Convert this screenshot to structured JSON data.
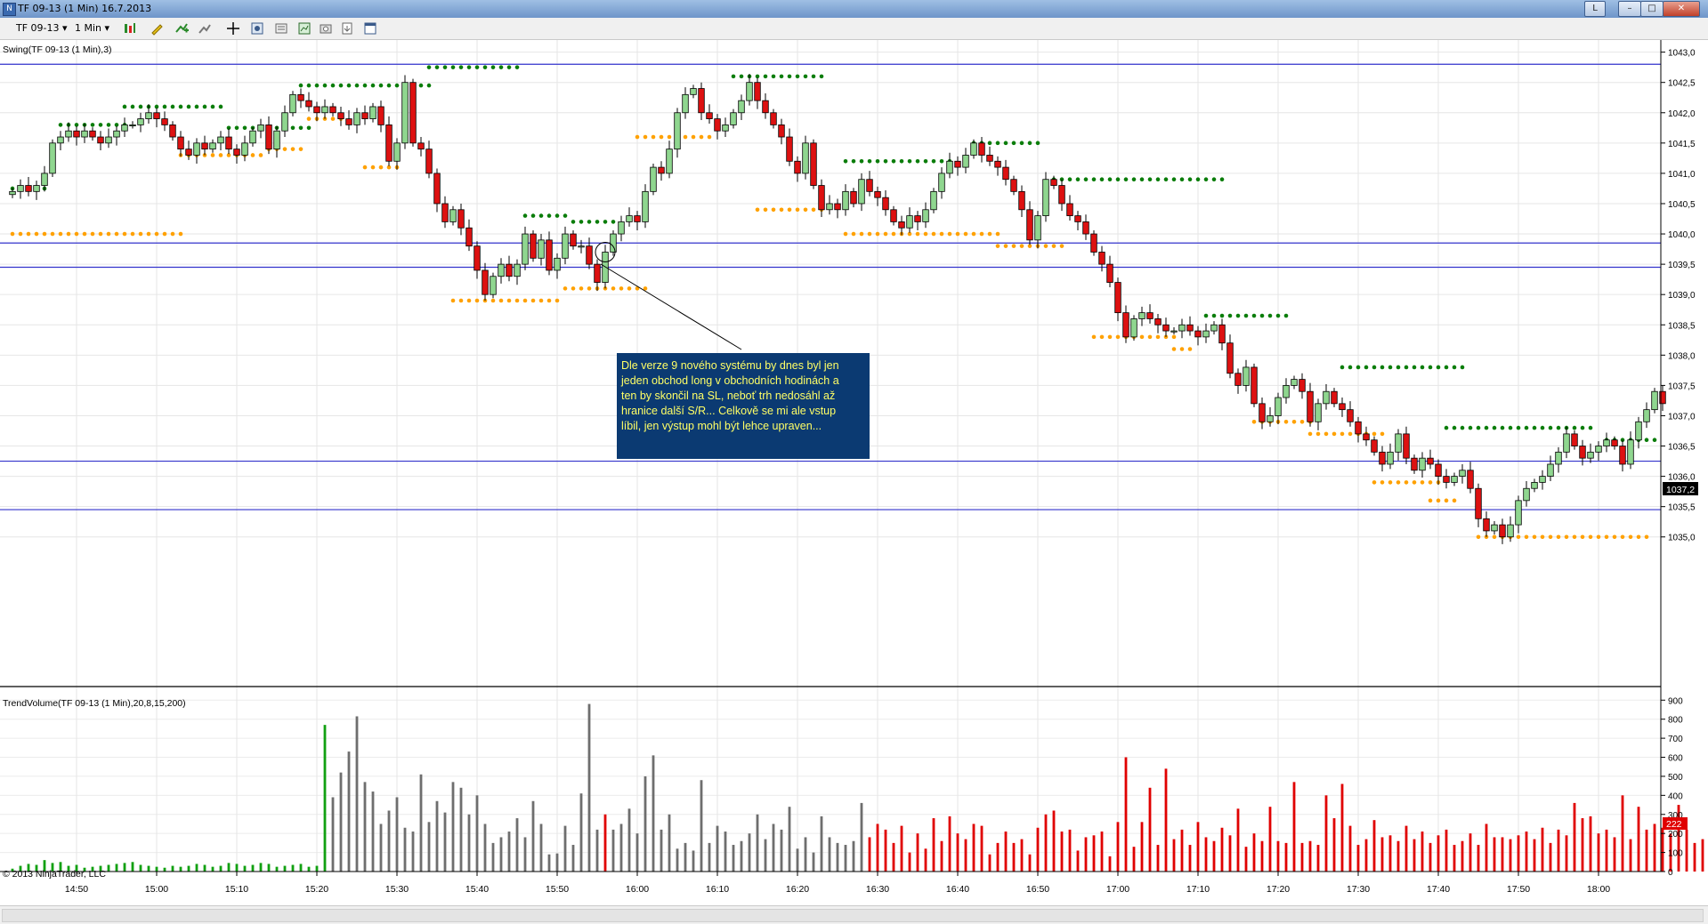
{
  "window": {
    "title": "TF 09-13 (1 Min)  16.7.2013",
    "buttons": [
      "L",
      "–",
      "□",
      "✕"
    ]
  },
  "toolbar": {
    "instrument": "TF 09-13",
    "interval": "1 Min"
  },
  "panels": {
    "price_label": "Swing(TF 09-13 (1 Min),3)",
    "volume_label": "TrendVolume(TF 09-13 (1 Min),20,8,15,200)",
    "copyright": "© 2013 NinjaTrader, LLC",
    "annotation_lines": [
      "Dle verze 9 nového systému by dnes byl jen",
      "jeden obchod long v obchodních hodinách a",
      "ten by skončil na SL, neboť trh nedosáhl až",
      "hranice další S/R... Celkově se mi ale vstup",
      "líbil, jen výstup mohl být lehce upraven..."
    ],
    "last_price": "1037,2",
    "last_volume": "222"
  },
  "chart_data": [
    {
      "type": "candlestick",
      "title": "Swing(TF 09-13 (1 Min),3)",
      "x_ticks": [
        "14:50",
        "15:00",
        "15:10",
        "15:20",
        "15:30",
        "15:40",
        "15:50",
        "16:00",
        "16:10",
        "16:20",
        "16:30",
        "16:40",
        "16:50",
        "17:00",
        "17:10",
        "17:20",
        "17:30",
        "17:40",
        "17:50",
        "18:00"
      ],
      "y_ticks": [
        "1043,0",
        "1042,5",
        "1042,0",
        "1041,5",
        "1041,0",
        "1040,5",
        "1040,0",
        "1039,5",
        "1039,0",
        "1038,5",
        "1038,0",
        "1037,5",
        "1037,0",
        "1036,5",
        "1036,0",
        "1035,5",
        "1035,0"
      ],
      "ylim": [
        1034.6,
        1043.2
      ],
      "x_start": "14:42",
      "close": [
        1040.7,
        1040.8,
        1040.7,
        1040.8,
        1041.0,
        1041.5,
        1041.6,
        1041.7,
        1041.6,
        1041.7,
        1041.6,
        1041.5,
        1041.6,
        1041.7,
        1041.8,
        1041.8,
        1041.9,
        1042.0,
        1041.9,
        1041.8,
        1041.6,
        1041.4,
        1041.3,
        1041.5,
        1041.4,
        1041.5,
        1041.6,
        1041.4,
        1041.3,
        1041.5,
        1041.7,
        1041.8,
        1041.4,
        1041.7,
        1042.0,
        1042.3,
        1042.2,
        1042.1,
        1042.0,
        1042.1,
        1042.0,
        1041.9,
        1041.8,
        1042.0,
        1041.9,
        1042.1,
        1041.8,
        1041.2,
        1041.5,
        1042.5,
        1041.5,
        1041.4,
        1041.0,
        1040.5,
        1040.2,
        1040.4,
        1040.1,
        1039.8,
        1039.4,
        1039.0,
        1039.3,
        1039.5,
        1039.3,
        1039.5,
        1040.0,
        1039.6,
        1039.9,
        1039.4,
        1039.6,
        1040.0,
        1039.8,
        1039.8,
        1039.5,
        1039.2,
        1039.7,
        1040.0,
        1040.2,
        1040.3,
        1040.2,
        1040.7,
        1041.1,
        1041.0,
        1041.4,
        1042.0,
        1042.3,
        1042.4,
        1042.0,
        1041.9,
        1041.7,
        1041.8,
        1042.0,
        1042.2,
        1042.5,
        1042.2,
        1042.0,
        1041.8,
        1041.6,
        1041.2,
        1041.0,
        1041.5,
        1040.8,
        1040.4,
        1040.5,
        1040.4,
        1040.7,
        1040.5,
        1040.9,
        1040.7,
        1040.6,
        1040.4,
        1040.2,
        1040.1,
        1040.3,
        1040.2,
        1040.4,
        1040.7,
        1041.0,
        1041.2,
        1041.1,
        1041.3,
        1041.5,
        1041.3,
        1041.2,
        1041.1,
        1040.9,
        1040.7,
        1040.4,
        1039.9,
        1040.3,
        1040.9,
        1040.8,
        1040.5,
        1040.3,
        1040.2,
        1040.0,
        1039.7,
        1039.5,
        1039.2,
        1038.7,
        1038.3,
        1038.6,
        1038.7,
        1038.6,
        1038.5,
        1038.4,
        1038.4,
        1038.5,
        1038.4,
        1038.3,
        1038.4,
        1038.5,
        1038.2,
        1037.7,
        1037.5,
        1037.8,
        1037.2,
        1036.9,
        1037.0,
        1037.3,
        1037.5,
        1037.6,
        1037.4,
        1036.9,
        1037.2,
        1037.4,
        1037.2,
        1037.1,
        1036.9,
        1036.7,
        1036.6,
        1036.4,
        1036.2,
        1036.4,
        1036.7,
        1036.3,
        1036.1,
        1036.3,
        1036.2,
        1036.0,
        1035.9,
        1036.0,
        1036.1,
        1035.8,
        1035.3,
        1035.1,
        1035.2,
        1035.0,
        1035.2,
        1035.6,
        1035.8,
        1035.9,
        1036.0,
        1036.2,
        1036.4,
        1036.7,
        1036.5,
        1036.3,
        1036.4,
        1036.5,
        1036.6,
        1036.5,
        1036.2,
        1036.6,
        1036.9,
        1037.1,
        1037.4,
        1037.2
      ]
    },
    {
      "type": "bar",
      "title": "TrendVolume(TF 09-13 (1 Min),20,8,15,200)",
      "y_ticks": [
        "900",
        "800",
        "700",
        "600",
        "500",
        "400",
        "300",
        "200",
        "100",
        "0"
      ],
      "ylim": [
        0,
        920
      ],
      "values": [
        15,
        30,
        40,
        35,
        60,
        45,
        50,
        30,
        35,
        20,
        25,
        30,
        35,
        40,
        45,
        50,
        35,
        30,
        25,
        20,
        30,
        25,
        30,
        40,
        35,
        25,
        30,
        45,
        40,
        30,
        35,
        45,
        40,
        25,
        30,
        35,
        40,
        25,
        30,
        770,
        390,
        520,
        630,
        815,
        470,
        420,
        250,
        320,
        390,
        230,
        210,
        510,
        260,
        370,
        310,
        470,
        440,
        300,
        400,
        250,
        150,
        180,
        210,
        280,
        180,
        370,
        250,
        90,
        95,
        240,
        140,
        410,
        880,
        220,
        300,
        220,
        250,
        330,
        200,
        500,
        610,
        220,
        300,
        120,
        150,
        110,
        480,
        150,
        240,
        210,
        140,
        160,
        200,
        300,
        170,
        250,
        220,
        340,
        120,
        180,
        100,
        290,
        180,
        150,
        140,
        160,
        360,
        180,
        250,
        220,
        150,
        240,
        100,
        200,
        120,
        280,
        160,
        290,
        200,
        170,
        250,
        240,
        90,
        150,
        210,
        150,
        170,
        90,
        230,
        300,
        320,
        210,
        220,
        110,
        180,
        190,
        210,
        80,
        260,
        600,
        130,
        260,
        440,
        140,
        540,
        170,
        220,
        140,
        260,
        180,
        160,
        230,
        190,
        330,
        130,
        200,
        160,
        340,
        160,
        150,
        470,
        150,
        160,
        140,
        400,
        280,
        460,
        240,
        140,
        170,
        270,
        180,
        190,
        160,
        240,
        170,
        210,
        150,
        190,
        220,
        140,
        160,
        200,
        140,
        250,
        180,
        180,
        170,
        190,
        210,
        170,
        230,
        150,
        220,
        190,
        360,
        280,
        290,
        200,
        220,
        180,
        400,
        170,
        340,
        220,
        250,
        230,
        200,
        350,
        220,
        150,
        170,
        200,
        180,
        160,
        200,
        150,
        210,
        350,
        160,
        220,
        140,
        190,
        560,
        170,
        230,
        250,
        280,
        190,
        240,
        160,
        180,
        250,
        222
      ],
      "colors": "green before 15:31, gray 15:31–15:56, red at 15:57, gray until 16:56, red after"
    }
  ],
  "horizontal_lines": [
    1042.8,
    1039.85,
    1039.45,
    1036.25,
    1035.45
  ],
  "swing_levels": {
    "resistance": [
      {
        "level": 1040.75,
        "from": 0,
        "to": 4
      },
      {
        "level": 1041.8,
        "from": 6,
        "to": 14
      },
      {
        "level": 1042.1,
        "from": 14,
        "to": 26
      },
      {
        "level": 1041.75,
        "from": 27,
        "to": 37
      },
      {
        "level": 1042.45,
        "from": 36,
        "to": 52
      },
      {
        "level": 1042.75,
        "from": 52,
        "to": 63
      },
      {
        "level": 1040.3,
        "from": 64,
        "to": 69
      },
      {
        "level": 1040.2,
        "from": 70,
        "to": 75
      },
      {
        "level": 1042.6,
        "from": 90,
        "to": 101
      },
      {
        "level": 1041.2,
        "from": 104,
        "to": 117
      },
      {
        "level": 1041.5,
        "from": 120,
        "to": 128
      },
      {
        "level": 1040.9,
        "from": 130,
        "to": 151
      },
      {
        "level": 1038.65,
        "from": 149,
        "to": 159
      },
      {
        "level": 1037.8,
        "from": 166,
        "to": 181
      },
      {
        "level": 1036.8,
        "from": 179,
        "to": 197
      },
      {
        "level": 1036.6,
        "from": 199,
        "to": 205
      }
    ],
    "support": [
      {
        "level": 1040.0,
        "from": 0,
        "to": 21
      },
      {
        "level": 1041.3,
        "from": 21,
        "to": 31
      },
      {
        "level": 1041.4,
        "from": 32,
        "to": 36
      },
      {
        "level": 1041.9,
        "from": 37,
        "to": 41
      },
      {
        "level": 1041.1,
        "from": 44,
        "to": 48
      },
      {
        "level": 1038.9,
        "from": 55,
        "to": 68
      },
      {
        "level": 1039.1,
        "from": 69,
        "to": 79
      },
      {
        "level": 1041.6,
        "from": 78,
        "to": 87
      },
      {
        "level": 1040.4,
        "from": 93,
        "to": 101
      },
      {
        "level": 1040.0,
        "from": 104,
        "to": 123
      },
      {
        "level": 1039.8,
        "from": 123,
        "to": 131
      },
      {
        "level": 1038.3,
        "from": 135,
        "to": 145
      },
      {
        "level": 1038.1,
        "from": 145,
        "to": 147
      },
      {
        "level": 1036.9,
        "from": 155,
        "to": 162
      },
      {
        "level": 1036.7,
        "from": 162,
        "to": 171
      },
      {
        "level": 1035.9,
        "from": 170,
        "to": 178
      },
      {
        "level": 1035.6,
        "from": 177,
        "to": 180
      },
      {
        "level": 1035.0,
        "from": 183,
        "to": 204
      }
    ]
  },
  "annotation_marker_bar": 74,
  "colors": {
    "up_body": "#8fd68f",
    "down_body": "#dd1111",
    "resistance": "#0a7d0a",
    "support": "#ffa100",
    "hline": "#3333cc",
    "annotation_bg": "#0b3a72",
    "annotation_text": "#ffff66"
  }
}
